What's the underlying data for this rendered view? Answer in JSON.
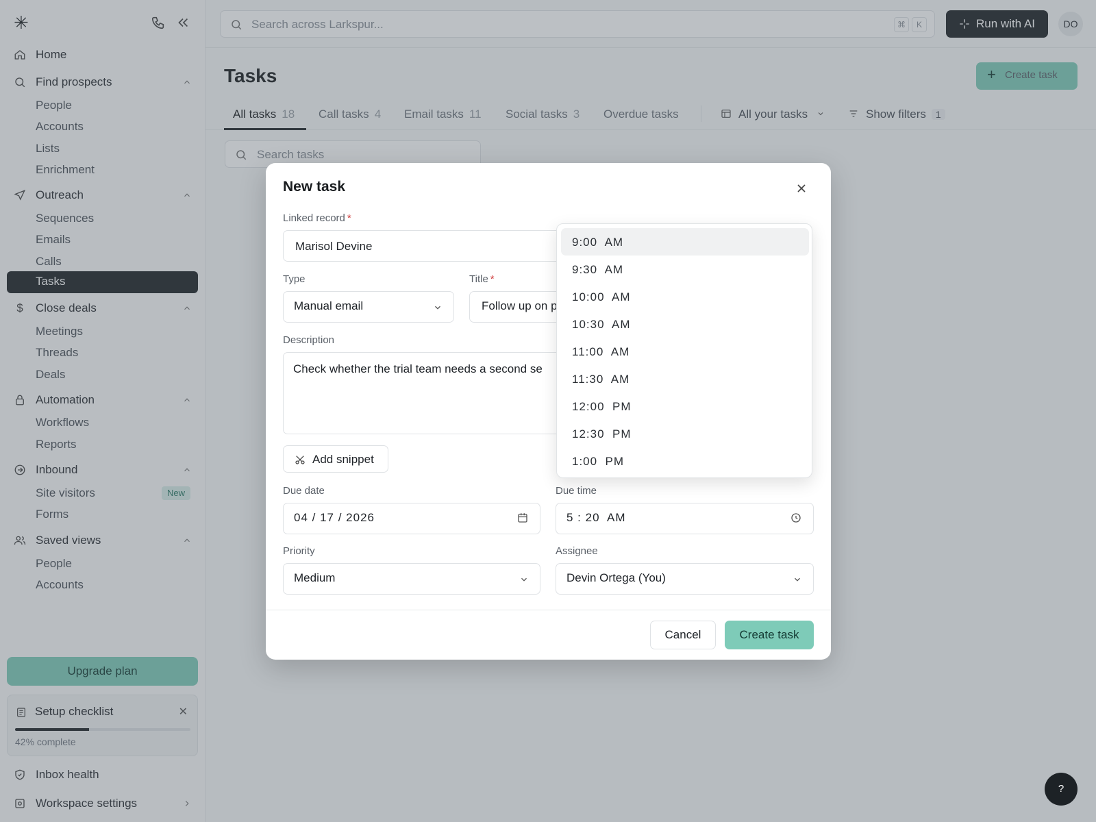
{
  "topbar": {
    "search_placeholder": "Search across Larkspur...",
    "shortcut_keys": [
      "⌘",
      "K"
    ],
    "run_ai_label": "Run with AI",
    "avatar_initials": "DO"
  },
  "sidebar": {
    "logo_glyph": "✳",
    "sections": [
      {
        "label": "Home"
      },
      {
        "label": "Find prospects",
        "items": [
          "People",
          "Accounts",
          "Lists",
          "Enrichment"
        ]
      },
      {
        "label": "Outreach",
        "items": [
          "Sequences",
          "Emails",
          "Calls",
          "Tasks"
        ]
      },
      {
        "label": "Close deals",
        "items": [
          "Meetings",
          "Threads",
          "Deals"
        ]
      },
      {
        "label": "Automation",
        "items": [
          "Workflows",
          "Reports"
        ]
      },
      {
        "label": "Inbound",
        "items": [
          "Site visitors",
          "Forms"
        ],
        "badge": "New"
      },
      {
        "label": "Saved views",
        "items": [
          "People",
          "Accounts"
        ]
      }
    ],
    "active_item": "Tasks",
    "upgrade_label": "Upgrade plan",
    "checklist": {
      "title": "Setup checklist",
      "progress": 0.42,
      "progress_label": "42% complete"
    },
    "footer": [
      {
        "label": "Inbox health"
      },
      {
        "label": "Workspace settings"
      }
    ]
  },
  "main": {
    "title": "Tasks",
    "create_label": "Create task",
    "tabs": [
      {
        "label": "All tasks",
        "count": "18"
      },
      {
        "label": "Call tasks",
        "count": "4"
      },
      {
        "label": "Email tasks",
        "count": "11"
      },
      {
        "label": "Social tasks",
        "count": "3"
      },
      {
        "label": "Overdue tasks",
        "count": ""
      }
    ],
    "view_select": "All your tasks",
    "filters_label": "Show filters",
    "filters_count": "1",
    "search_placeholder": "Search tasks",
    "help_label": "?"
  },
  "modal": {
    "title": "New task",
    "linked_record": {
      "label": "Linked record",
      "required": "*",
      "value": "Marisol Devine"
    },
    "type": {
      "label": "Type",
      "value": "Manual email"
    },
    "title_field": {
      "label": "Title",
      "required": "*",
      "value": "Follow up on p"
    },
    "description": {
      "label": "Description",
      "value": "Check whether the trial team needs a second se"
    },
    "snippet_label": "Add snippet",
    "due_date": {
      "label": "Due date",
      "value": "04 / 17 / 2026"
    },
    "due_time": {
      "label": "Due time",
      "value": "5 : 20  AM"
    },
    "priority": {
      "label": "Priority",
      "value": "Medium"
    },
    "assignee": {
      "label": "Assignee",
      "value": "Devin Ortega (You)"
    },
    "cancel_label": "Cancel",
    "create_label": "Create task",
    "time_options": [
      "9:00  AM",
      "9:30  AM",
      "10:00  AM",
      "10:30  AM",
      "11:00  AM",
      "11:30  AM",
      "12:00  PM",
      "12:30  PM",
      "1:00  PM"
    ],
    "selected_time_index": 0
  },
  "colors": {
    "accent": "#7ecbb8",
    "dark": "#1d2226",
    "required": "#d14343"
  }
}
